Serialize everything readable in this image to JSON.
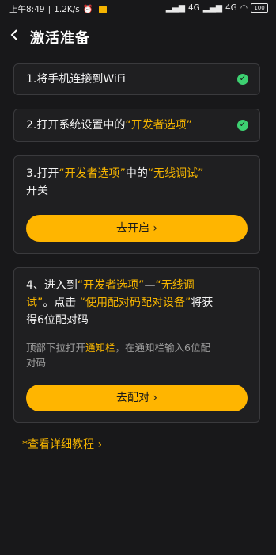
{
  "status": {
    "time": "上午8:49",
    "speed": "1.2K/s",
    "signal1": "4G",
    "signal2": "4G",
    "battery": "100"
  },
  "header": {
    "title": "激活准备",
    "back_icon": "chevron-left-icon"
  },
  "steps": [
    {
      "prefix": "1.将手机连接到WiFi",
      "done": true
    },
    {
      "prefix": "2.打开系统设置中的",
      "highlight": "“开发者选项”",
      "done": true
    },
    {
      "line1_prefix": "3.打开",
      "line1_hl1": "“开发者选项”",
      "line1_mid": "中的",
      "line1_hl2": "“无线调试”",
      "line2": "开关",
      "button": "去开启 ›"
    },
    {
      "line1_prefix": "4、进入到",
      "line1_hl1": "“开发者选项”",
      "line1_mid": "—",
      "line1_hl2": "“无线调",
      "line2_hl": "试”",
      "line2_mid": "。点击 ",
      "line2_hl2": "“使用配对码配对设备”",
      "line2_suffix": "将获",
      "line3": "得6位配对码",
      "sub_prefix": "顶部下拉打开",
      "sub_hl": "通知栏",
      "sub_suffix": "，在通知栏输入6位配",
      "sub_line2": "对码",
      "button": "去配对 ›"
    }
  ],
  "tutorial": "*查看详细教程 ›",
  "colors": {
    "accent": "#ffb500",
    "check": "#3dd071",
    "background": "#18181a"
  }
}
